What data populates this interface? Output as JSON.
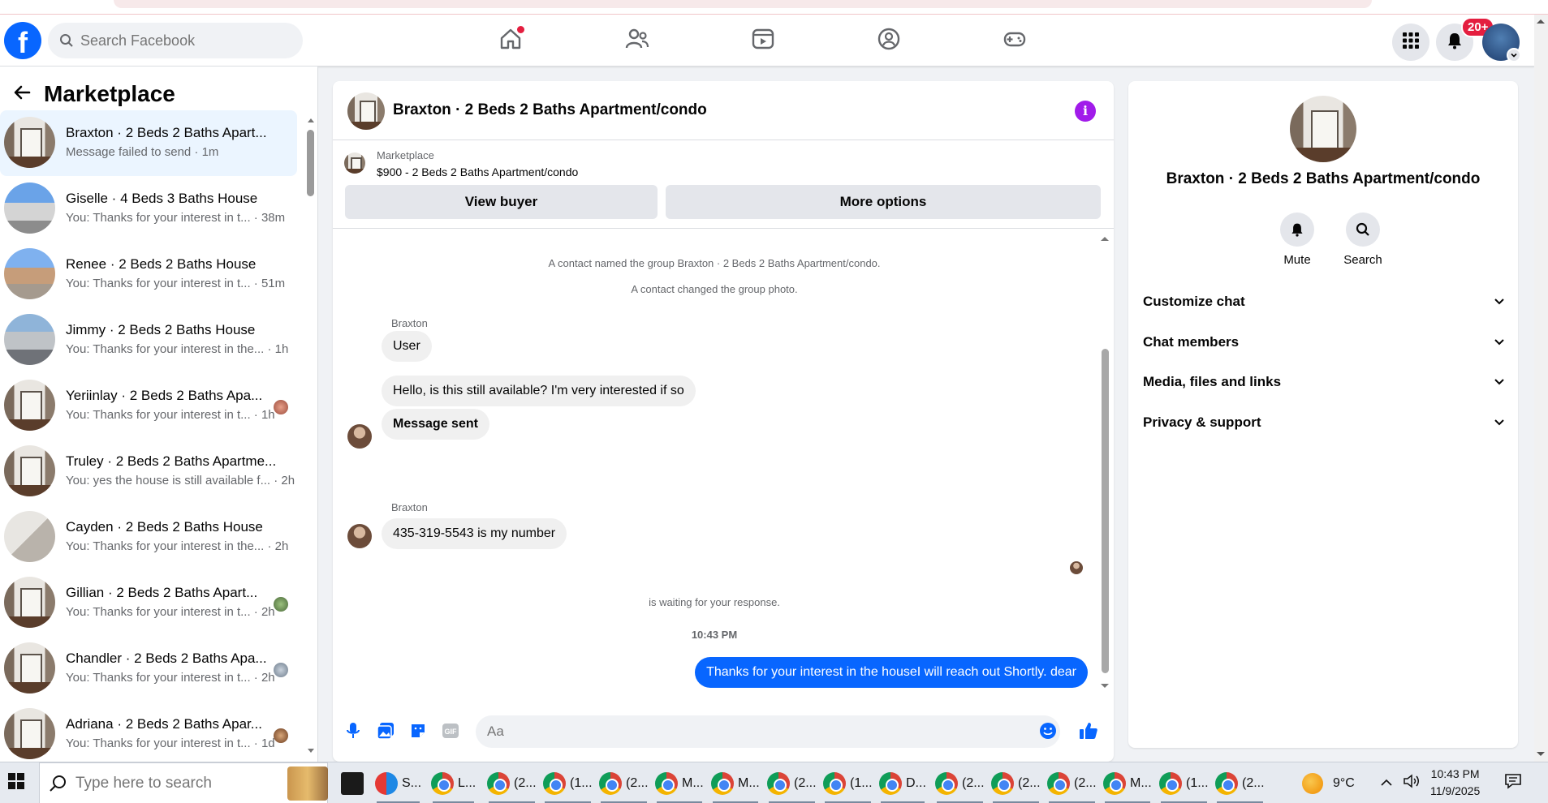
{
  "header": {
    "logo_letter": "f",
    "search_placeholder": "Search Facebook",
    "notifications_badge": "20+"
  },
  "sidebar": {
    "title": "Marketplace",
    "conversations": [
      {
        "name": "Braxton · 2 Beds 2 Baths Apart...",
        "preview": "Message failed to send · 1m",
        "active": true
      },
      {
        "name": "Giselle · 4 Beds 3 Baths House",
        "preview": "You: Thanks for your interest in t... · 38m"
      },
      {
        "name": "Renee · 2 Beds 2 Baths House",
        "preview": "You: Thanks for your interest in t... · 51m"
      },
      {
        "name": "Jimmy · 2 Beds 2 Baths House",
        "preview": "You: Thanks for your interest in the... · 1h"
      },
      {
        "name": "Yeriinlay · 2 Beds 2 Baths Apa...",
        "preview": "You: Thanks for your interest in t... · 1h"
      },
      {
        "name": "Truley · 2 Beds 2 Baths Apartme...",
        "preview": "You: yes the house is still available f... · 2h"
      },
      {
        "name": "Cayden · 2 Beds 2 Baths House",
        "preview": "You: Thanks for your interest in the... · 2h"
      },
      {
        "name": "Gillian · 2 Beds 2 Baths Apart...",
        "preview": "You: Thanks for your interest in t... · 2h"
      },
      {
        "name": "Chandler · 2 Beds 2 Baths Apa...",
        "preview": "You: Thanks for your interest in t... · 2h"
      },
      {
        "name": "Adriana · 2 Beds 2 Baths Apar...",
        "preview": "You: Thanks for your interest in t... · 1d"
      }
    ]
  },
  "chat": {
    "title": "Braxton · 2 Beds 2 Baths Apartment/condo",
    "marketplace_label": "Marketplace",
    "listing": "$900 - 2 Beds 2 Baths Apartment/condo",
    "view_buyer": "View buyer",
    "more_options": "More options",
    "system_1": "A contact named the group Braxton · 2 Beds 2 Baths Apartment/condo.",
    "system_2": "A contact changed the group photo.",
    "sender_1": "Braxton",
    "msg_1": "User",
    "msg_2": "Hello, is this still available? I'm very interested if so",
    "msg_3": "Message sent",
    "sender_2": "Braxton",
    "msg_4": "435-319-5543 is my number",
    "waiting": "is waiting for your response.",
    "time": "10:43 PM",
    "outgoing": "Thanks for your interest in the houseI will reach out Shortly. dear",
    "composer_placeholder": "Aa"
  },
  "info_panel": {
    "name": "Braxton · 2 Beds 2 Baths Apartment/condo",
    "mute": "Mute",
    "search": "Search",
    "sections": [
      "Customize chat",
      "Chat members",
      "Media, files and links",
      "Privacy & support"
    ]
  },
  "taskbar": {
    "search_placeholder": "Type here to search",
    "apps": [
      "S...",
      "L...",
      "(2...",
      "(1...",
      "(2...",
      "M...",
      "M...",
      "(2...",
      "(1...",
      "D...",
      "(2...",
      "(2...",
      "(2...",
      "M...",
      "(1...",
      "(2..."
    ],
    "temperature": "9°C",
    "time": "10:43 PM",
    "date": "11/9/2025"
  },
  "colors": {
    "brand_blue": "#0866ff",
    "info_purple": "#a11bea",
    "badge_red": "#e41e3f"
  }
}
